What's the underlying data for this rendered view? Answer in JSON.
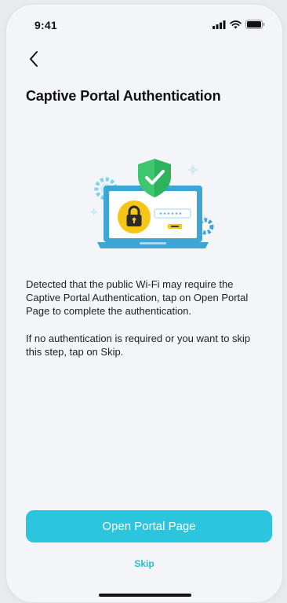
{
  "status_bar": {
    "time": "9:41",
    "icons": [
      "signal-icon",
      "wifi-icon",
      "battery-icon"
    ]
  },
  "nav": {
    "back_icon": "chevron-left-icon"
  },
  "page": {
    "title": "Captive Portal Authentication",
    "illustration_icons": [
      "laptop-icon",
      "padlock-icon",
      "shield-check-icon",
      "gear-icon"
    ],
    "description_1": "Detected that the public Wi-Fi may require the Captive Portal Authentication, tap on Open Portal Page to complete the authentication.",
    "description_2": "If no authentication is required or you want to skip this step, tap on Skip."
  },
  "actions": {
    "primary_label": "Open Portal Page",
    "skip_label": "Skip"
  },
  "colors": {
    "accent": "#2bc6dd",
    "background": "#f3f5f9",
    "shield": "#3fc66e",
    "lock": "#f5c518"
  }
}
